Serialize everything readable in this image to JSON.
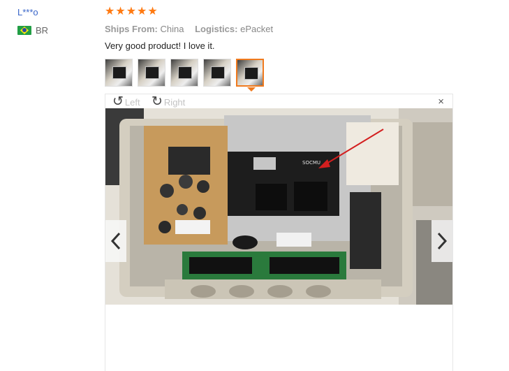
{
  "reviewer": {
    "name": "L***o",
    "country_code": "BR"
  },
  "rating": {
    "stars": 5,
    "max": 5,
    "color": "#ff7a12"
  },
  "shipping": {
    "ships_from_label": "Ships From:",
    "ships_from_value": "China",
    "logistics_label": "Logistics:",
    "logistics_value": "ePacket"
  },
  "review": {
    "text": "Very good product! I love it."
  },
  "thumbnails": {
    "count": 5,
    "selected_index": 4,
    "selected_color": "#f07a1e"
  },
  "viewer": {
    "rotate_left_label": "Left",
    "rotate_right_label": "Right",
    "close_glyph": "×",
    "annotation": {
      "board_text": "SOCMU",
      "arrow_color": "#d31f1f"
    }
  },
  "icons": {
    "rotate_left": "rotate-left-icon",
    "rotate_right": "rotate-right-icon",
    "close": "close-icon",
    "prev": "chevron-left-icon",
    "next": "chevron-right-icon"
  }
}
